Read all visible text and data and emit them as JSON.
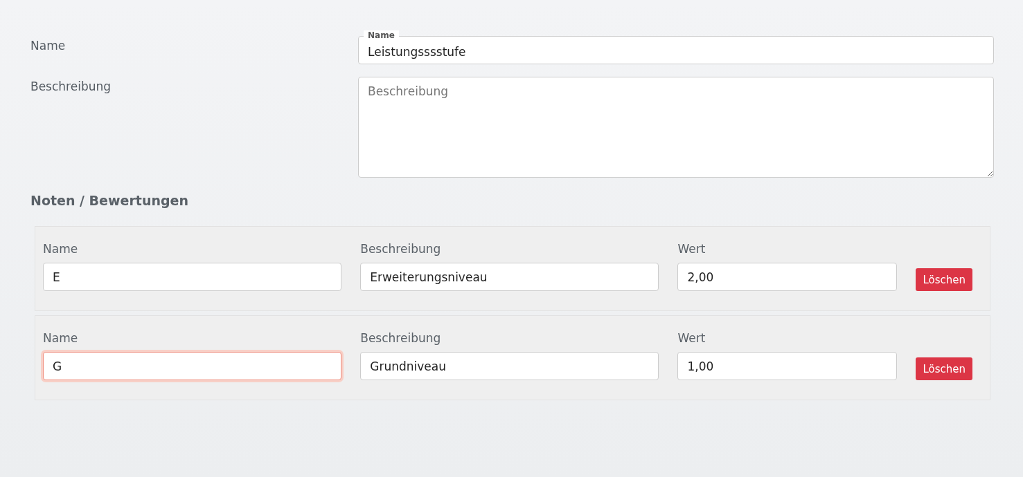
{
  "form": {
    "name": {
      "label": "Name",
      "floating_label": "Name",
      "value": "Leistungsssstufe"
    },
    "description": {
      "label": "Beschreibung",
      "placeholder": "Beschreibung"
    }
  },
  "grades": {
    "title": "Noten / Bewertungen",
    "rows": [
      {
        "fields": [
          {
            "label": "Name",
            "value": "E",
            "focused": false
          },
          {
            "label": "Beschreibung",
            "value": "Erweiterungsniveau",
            "focused": false
          },
          {
            "label": "Wert",
            "value": "2,00",
            "focused": false
          }
        ],
        "delete_button": "Löschen"
      },
      {
        "fields": [
          {
            "label": "Name",
            "value": "G",
            "focused": true
          },
          {
            "label": "Beschreibung",
            "value": "Grundniveau",
            "focused": false
          },
          {
            "label": "Wert",
            "value": "1,00",
            "focused": false
          }
        ],
        "delete_button": "Löschen"
      }
    ]
  }
}
